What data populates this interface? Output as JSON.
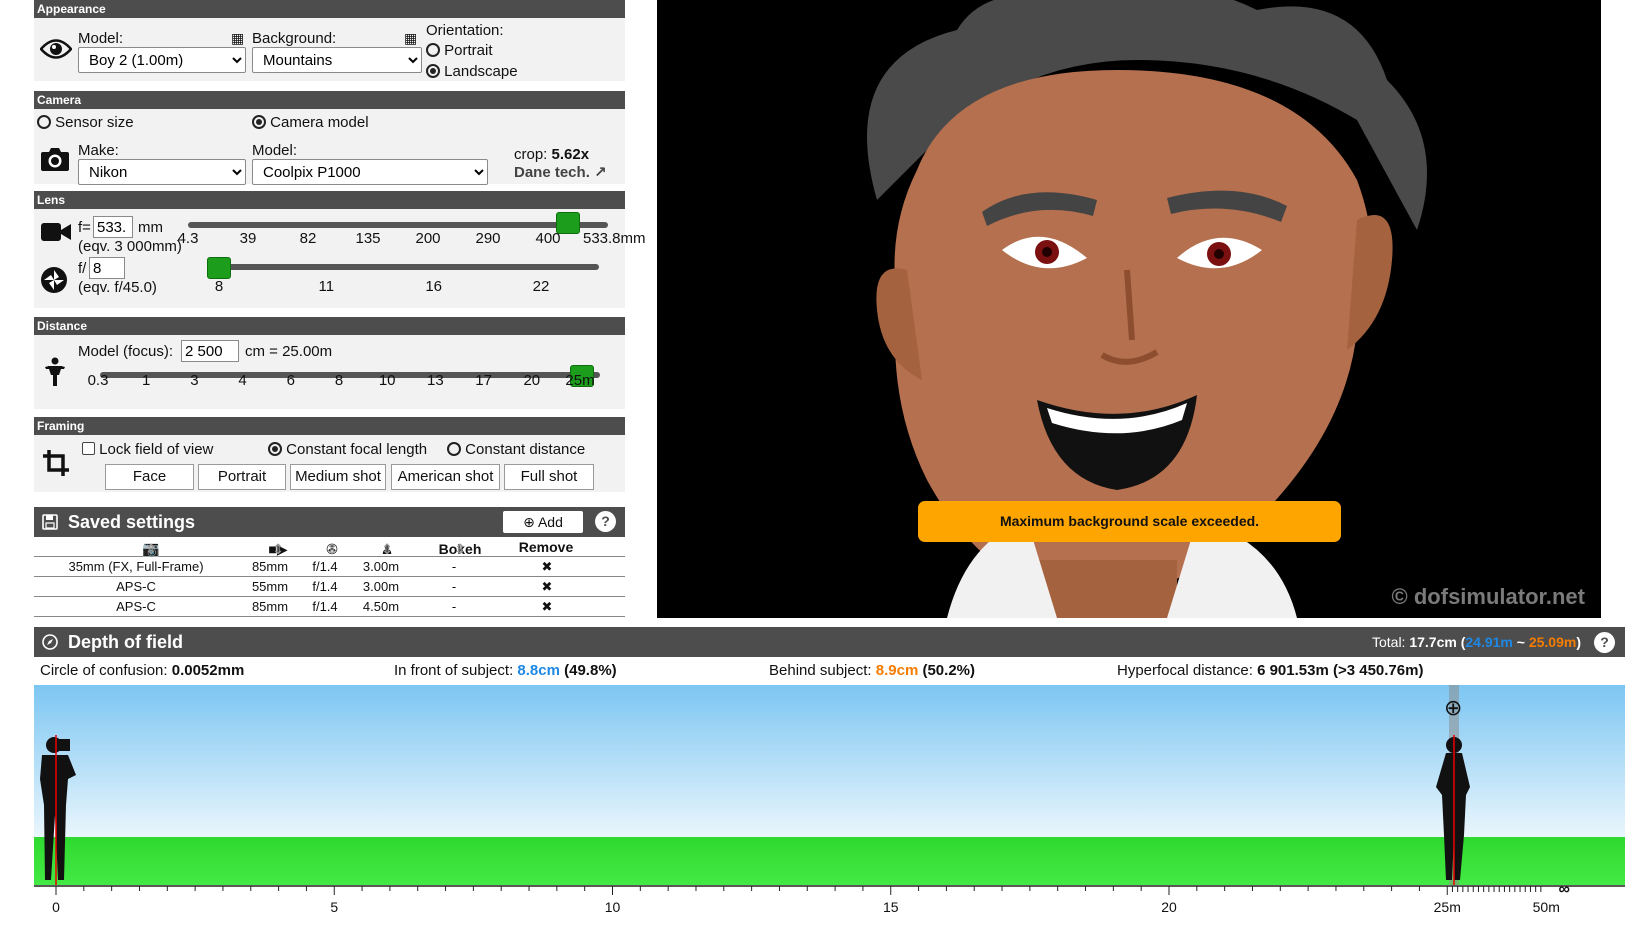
{
  "appearance": {
    "header": "Appearance",
    "model_label": "Model:",
    "model_value": "Boy 2 (1.00m)",
    "background_label": "Background:",
    "background_value": "Mountains",
    "orientation_label": "Orientation:",
    "portrait_label": "Portrait",
    "landscape_label": "Landscape",
    "orientation_selected": "Landscape"
  },
  "camera": {
    "header": "Camera",
    "sensor_size_label": "Sensor size",
    "camera_model_label": "Camera model",
    "mode_selected": "Camera model",
    "make_label": "Make:",
    "make_value": "Nikon",
    "model_label": "Model:",
    "model_value": "Coolpix P1000",
    "crop_label": "crop:",
    "crop_value": "5.62x",
    "dane_tech_link": "Dane tech."
  },
  "lens": {
    "header": "Lens",
    "focal_prefix": "f=",
    "focal_value": "533.",
    "focal_unit": "mm",
    "focal_equiv": "(eqv. 3 000mm)",
    "focal_ticks": [
      "4.3",
      "39",
      "82",
      "135",
      "200",
      "290",
      "400",
      "533.8mm"
    ],
    "focal_slider_fraction": 1.0,
    "aperture_prefix": "f/",
    "aperture_value": "8",
    "aperture_equiv": "(eqv. f/45.0)",
    "aperture_ticks": [
      "8",
      "11",
      "16",
      "22"
    ],
    "aperture_slider_fraction": 0.0
  },
  "distance": {
    "header": "Distance",
    "focus_label": "Model (focus):",
    "focus_value": "2 500",
    "focus_result": "cm = 25.00m",
    "ticks": [
      "0.3",
      "1",
      "3",
      "4",
      "6",
      "8",
      "10",
      "13",
      "17",
      "20",
      "25m"
    ],
    "slider_fraction": 1.0
  },
  "framing": {
    "header": "Framing",
    "lock_fov_label": "Lock field of view",
    "const_focal_label": "Constant focal length",
    "const_distance_label": "Constant distance",
    "mode_selected": "Constant focal length",
    "buttons": [
      "Face",
      "Portrait",
      "Medium shot",
      "American shot",
      "Full shot"
    ]
  },
  "saved": {
    "title": "Saved settings",
    "add_label": "Add",
    "columns": [
      "/",
      "",
      "",
      "",
      "Bokeh",
      "Remove"
    ],
    "rows": [
      {
        "sensor": "35mm (FX, Full-Frame)",
        "focal": "85mm",
        "aperture": "f/1.4",
        "distance": "3.00m",
        "bokeh": "-",
        "remove": "✖"
      },
      {
        "sensor": "APS-C",
        "focal": "55mm",
        "aperture": "f/1.4",
        "distance": "3.00m",
        "bokeh": "-",
        "remove": "✖"
      },
      {
        "sensor": "APS-C",
        "focal": "85mm",
        "aperture": "f/1.4",
        "distance": "4.50m",
        "bokeh": "-",
        "remove": "✖"
      }
    ]
  },
  "preview": {
    "warning": "Maximum background scale exceeded.",
    "watermark": "© dofsimulator.net"
  },
  "dof": {
    "title": "Depth of field",
    "total_label": "Total:",
    "total_value": "17.7cm",
    "range_open": "(",
    "range_near": "24.91m",
    "range_sep": " ~ ",
    "range_far": "25.09m",
    "range_close": ")",
    "coc_label": "Circle of confusion:",
    "coc_value": "0.0052mm",
    "front_label": "In front of subject:",
    "front_value": "8.8cm",
    "front_pct": "(49.8%)",
    "behind_label": "Behind subject:",
    "behind_value": "8.9cm",
    "behind_pct": "(50.2%)",
    "hyperfocal_label": "Hyperfocal distance:",
    "hyperfocal_value": "6 901.53m (>3 450.76m)",
    "ruler_labels": [
      "0",
      "5",
      "10",
      "15",
      "20",
      "25m",
      "50m",
      "∞"
    ],
    "near_color": "#1e88e5",
    "far_color": "#f57c00"
  },
  "colors": {
    "header_bg": "#4d4d4d",
    "slider_green": "#1c9d1c",
    "warning_orange": "#ffa500"
  }
}
